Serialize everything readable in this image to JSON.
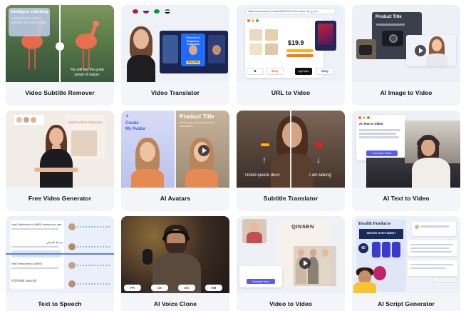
{
  "tools": [
    {
      "label": "Video Subtitle Remover",
      "icon": "subtitle-remover-thumb",
      "overlay_title": "Intelligent subtitling",
      "overlay_sub": "Automatically remove subtitles and watermarks",
      "caption_line1": "You will feel the great",
      "caption_line2": "power of nature"
    },
    {
      "label": "Video Translator",
      "icon": "translator-thumb",
      "promo_top": "Welcome to",
      "promo_mid": "Seamless Collection",
      "promo_btn": "Shop Now"
    },
    {
      "label": "URL to Video",
      "icon": "url-to-video-thumb",
      "url_text": "https://www.amazon.com/dp/B0BJ9VK1D2?th=1&psc=1&_rp_id=...",
      "price": "$19.9",
      "store1": "a",
      "store2": "Etsy",
      "store3": "App Store",
      "store4": "ebay"
    },
    {
      "label": "AI Image to Video",
      "icon": "image-to-video-thumb",
      "card_title": "Product Title"
    },
    {
      "label": "Free Video Generator",
      "icon": "free-video-generator-thumb",
      "mini_title": "Bold Fashion Collection"
    },
    {
      "label": "AI Avatars",
      "icon": "ai-avatars-thumb",
      "create_line1": "Create",
      "create_line2": "My Avatar",
      "plus": "+",
      "product_title": "Product Title",
      "product_desc": "Introducing our latest product description..."
    },
    {
      "label": "Subtitle Translator",
      "icon": "subtitle-translator-thumb",
      "sub_left": "Usted quiere decir",
      "sub_right": "I am talking"
    },
    {
      "label": "AI Text to Video",
      "icon": "ai-text-to-video-thumb",
      "dialog_title": "AI Text to Video",
      "dialog_btn": "Generate Video"
    },
    {
      "label": "Text to Speech",
      "icon": "text-to-speech-thumb",
      "line1": "Hey! Welcome to VMEG where you can",
      "line2": "مرحبا بكم في",
      "line3": "Hey! Welcome to VMEG",
      "line4": "안녕하세요 VMEG에"
    },
    {
      "label": "AI Voice Clone",
      "icon": "ai-voice-clone-thumb",
      "lang1": "FR",
      "lang2": "US",
      "lang3": "ES",
      "lang4": "KR"
    },
    {
      "label": "Video to Video",
      "icon": "video-to-video-thumb",
      "brand": "QINSEN",
      "btn": "Generate Video"
    },
    {
      "label": "AI Script Generator",
      "icon": "ai-script-generator-thumb",
      "heading": "Health Products",
      "sub": "DIETARY SUPPLEMENT",
      "badge": "60"
    }
  ],
  "colors": {
    "card_bg": "#f3f5f9",
    "accent": "#5b5bf0",
    "label": "#111318"
  }
}
